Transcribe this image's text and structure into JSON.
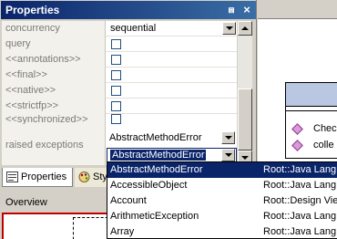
{
  "panel": {
    "title": "Properties",
    "pin_glyph": "⩎",
    "close_glyph": "×"
  },
  "properties": [
    {
      "name": "concurrency",
      "type": "combo",
      "value": "sequential"
    },
    {
      "name": "query",
      "type": "checkbox",
      "checked": false
    },
    {
      "name": "<<annotations>>",
      "type": "checkbox",
      "checked": false
    },
    {
      "name": "<<final>>",
      "type": "checkbox",
      "checked": false
    },
    {
      "name": "<<native>>",
      "type": "checkbox",
      "checked": false
    },
    {
      "name": "<<strictfp>>",
      "type": "checkbox",
      "checked": false
    },
    {
      "name": "<<synchronized>>",
      "type": "checkbox",
      "checked": false
    }
  ],
  "raised": {
    "label": "raised exceptions",
    "items": [
      "AbstractMethodError",
      "AbstractMethodError"
    ]
  },
  "tabs": [
    {
      "label": "Properties",
      "icon": "properties-icon",
      "active": true
    },
    {
      "label": "Sty",
      "icon": "styles-icon",
      "active": false
    }
  ],
  "overview": {
    "title": "Overview"
  },
  "diagram": {
    "members": [
      "Chec",
      "colle"
    ]
  },
  "dropdown": {
    "items": [
      {
        "name": "AbstractMethodError",
        "path": "Root::Java Lang:",
        "selected": true
      },
      {
        "name": "AccessibleObject",
        "path": "Root::Java Lang:",
        "selected": false
      },
      {
        "name": "Account",
        "path": "Root::Design Vie",
        "selected": false
      },
      {
        "name": "ArithmeticException",
        "path": "Root::Java Lang:",
        "selected": false
      },
      {
        "name": "Array",
        "path": "Root::Java Lang:",
        "selected": false
      }
    ]
  },
  "colors": {
    "titlebar": "#0a246a",
    "selection": "#0a246a",
    "member_icon": "#d99ad9",
    "class_header": "#b9c7e3"
  }
}
